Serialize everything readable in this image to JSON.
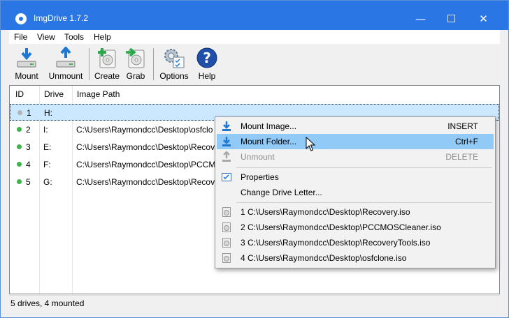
{
  "window": {
    "title": "ImgDrive 1.7.2",
    "minimize_glyph": "—",
    "maximize_glyph": "☐",
    "close_glyph": "✕"
  },
  "menubar": {
    "items": [
      "File",
      "View",
      "Tools",
      "Help"
    ]
  },
  "toolbar": {
    "mount": "Mount",
    "unmount": "Unmount",
    "create": "Create",
    "grab": "Grab",
    "options": "Options",
    "help": "Help"
  },
  "list": {
    "columns": [
      "ID",
      "Drive",
      "Image Path"
    ],
    "rows": [
      {
        "id": "1",
        "drive": "H:",
        "path": "",
        "mounted": false
      },
      {
        "id": "2",
        "drive": "I:",
        "path": "C:\\Users\\Raymondcc\\Desktop\\osfclo",
        "mounted": true
      },
      {
        "id": "3",
        "drive": "E:",
        "path": "C:\\Users\\Raymondcc\\Desktop\\Recov",
        "mounted": true
      },
      {
        "id": "4",
        "drive": "F:",
        "path": "C:\\Users\\Raymondcc\\Desktop\\PCCM",
        "mounted": true
      },
      {
        "id": "5",
        "drive": "G:",
        "path": "C:\\Users\\Raymondcc\\Desktop\\Recov",
        "mounted": true
      }
    ]
  },
  "context_menu": {
    "mount_image": "Mount Image...",
    "mount_image_shortcut": "INSERT",
    "mount_folder": "Mount Folder...",
    "mount_folder_shortcut": "Ctrl+F",
    "unmount": "Unmount",
    "unmount_shortcut": "DELETE",
    "properties": "Properties",
    "change_drive_letter": "Change Drive Letter...",
    "recent": [
      "1 C:\\Users\\Raymondcc\\Desktop\\Recovery.iso",
      "2 C:\\Users\\Raymondcc\\Desktop\\PCCMOSCleaner.iso",
      "3 C:\\Users\\Raymondcc\\Desktop\\RecoveryTools.iso",
      "4 C:\\Users\\Raymondcc\\Desktop\\osfclone.iso"
    ]
  },
  "status": {
    "text": "5 drives, 4 mounted"
  },
  "colors": {
    "titlebar": "#2b76e5",
    "selection": "#cce8ff",
    "menu_highlight": "#91c9f7",
    "mounted_dot": "#3cb44a",
    "unmounted_dot": "#b4b4b4"
  },
  "icons": {
    "mount": "mount-drive-icon",
    "unmount": "unmount-drive-icon",
    "create": "create-disc-icon",
    "grab": "grab-disc-icon",
    "options": "options-gear-icon",
    "help": "help-question-icon"
  }
}
